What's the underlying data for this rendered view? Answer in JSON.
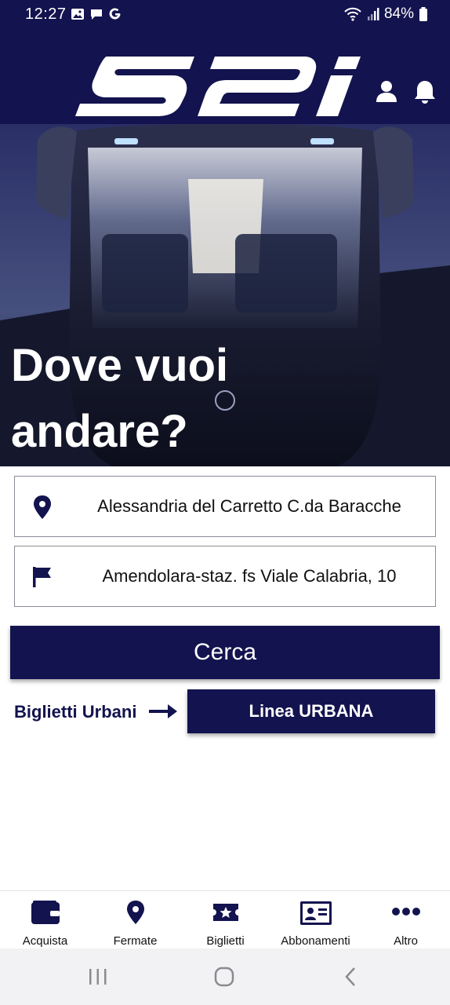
{
  "status_bar": {
    "time": "12:27",
    "battery": "84%",
    "notification_icons": [
      "gallery-icon",
      "chat-icon",
      "google-icon"
    ]
  },
  "header": {
    "logo_text": "S2I",
    "brand_color": "#13134f"
  },
  "hero": {
    "title_line1": "Dove vuoi",
    "title_line2": "andare?"
  },
  "search": {
    "origin": "Alessandria del Carretto C.da Baracche",
    "destination": "Amendolara-staz. fs Viale Calabria, 10",
    "submit_label": "Cerca"
  },
  "urban": {
    "label": "Biglietti Urbani",
    "button_label": "Linea URBANA"
  },
  "bottom_nav": {
    "items": [
      {
        "label": "Acquista",
        "icon": "wallet-icon"
      },
      {
        "label": "Fermate",
        "icon": "location-pin-icon"
      },
      {
        "label": "Biglietti",
        "icon": "ticket-icon"
      },
      {
        "label": "Abbonamenti",
        "icon": "id-card-icon"
      },
      {
        "label": "Altro",
        "icon": "more-icon"
      }
    ]
  }
}
